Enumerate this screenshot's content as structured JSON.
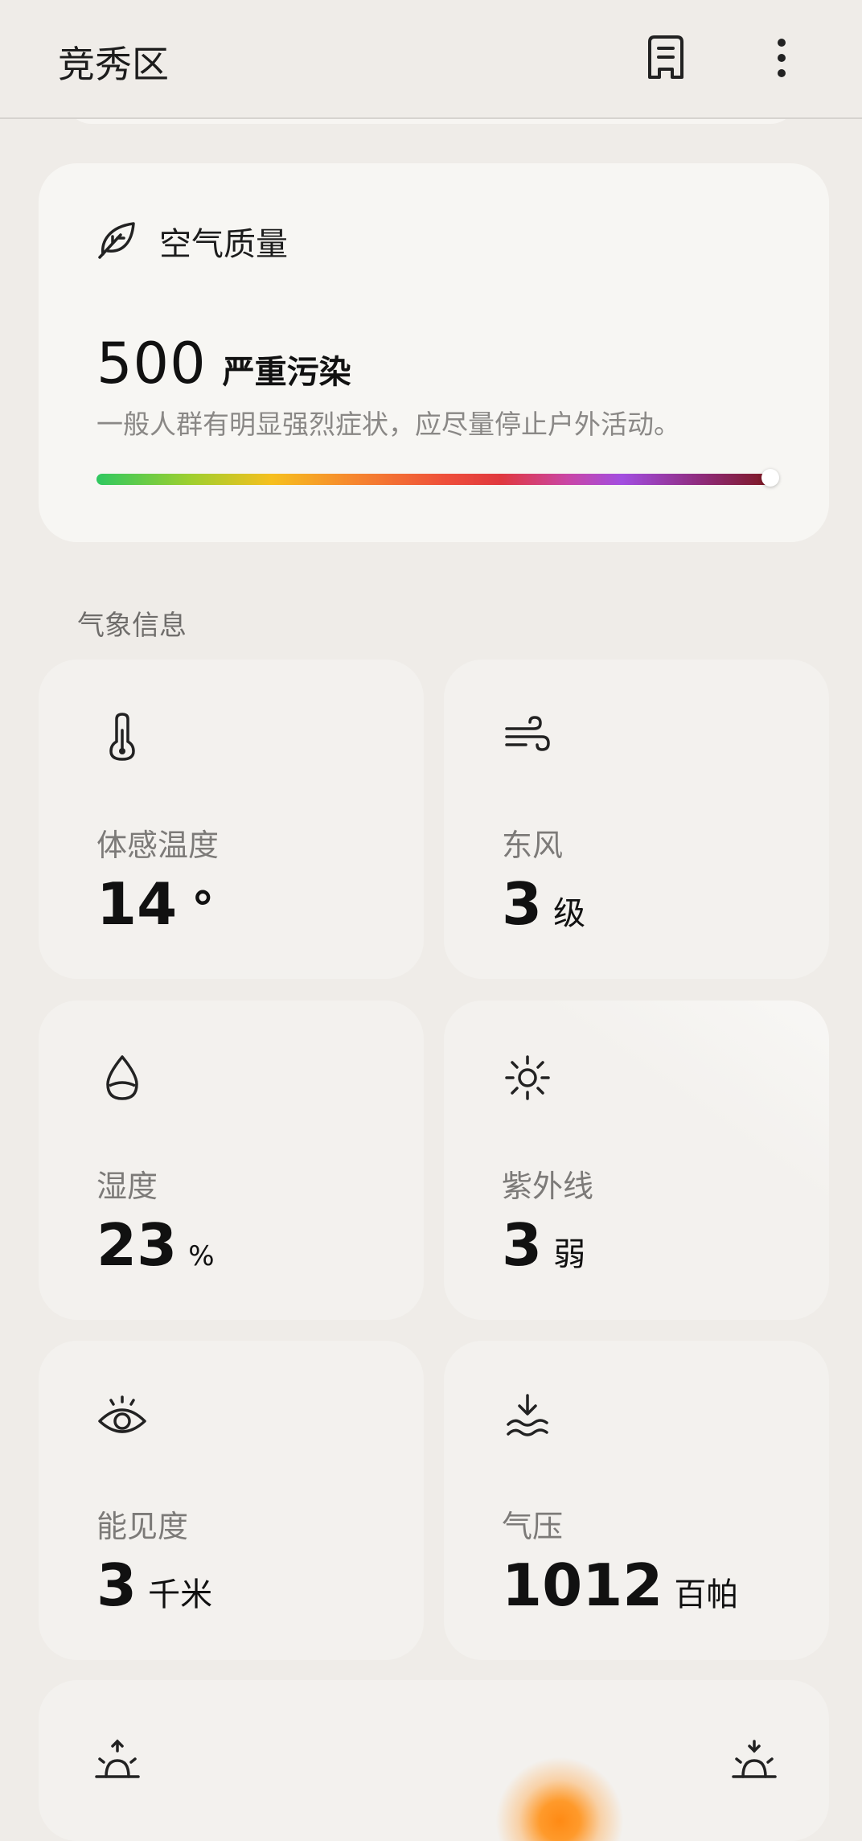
{
  "header": {
    "title": "竞秀区",
    "icons": [
      "document-icon",
      "more-vertical-icon"
    ]
  },
  "air_quality": {
    "icon": "leaf-icon",
    "label": "空气质量",
    "value": "500",
    "level": "严重污染",
    "description": "一般人群有明显强烈症状，应尽量停止户外活动。",
    "indicator_percent": 100
  },
  "weather_section": {
    "title": "气象信息",
    "tiles": [
      {
        "icon": "thermometer-icon",
        "label": "体感温度",
        "value": "14",
        "unit": "°"
      },
      {
        "icon": "wind-icon",
        "label": "东风",
        "value": "3",
        "unit": "级"
      },
      {
        "icon": "droplet-icon",
        "label": "湿度",
        "value": "23",
        "unit": "%"
      },
      {
        "icon": "sun-icon",
        "label": "紫外线",
        "value": "3",
        "unit": "弱"
      },
      {
        "icon": "eye-icon",
        "label": "能见度",
        "value": "3",
        "unit": "千米"
      },
      {
        "icon": "pressure-icon",
        "label": "气压",
        "value": "1012",
        "unit": "百帕"
      }
    ]
  },
  "sun_card": {
    "icons": [
      "sunrise-icon",
      "sunset-icon"
    ],
    "accent": "#ff8a14"
  }
}
